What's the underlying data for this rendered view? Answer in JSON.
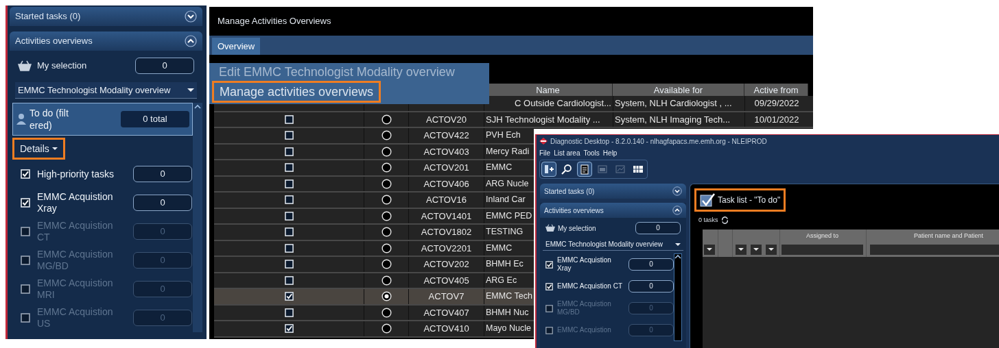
{
  "sidebar": {
    "started_tasks": {
      "label": "Started tasks (0)",
      "expanded": false
    },
    "activities": {
      "label": "Activities overviews",
      "expanded": true
    },
    "my_selection": {
      "label": "My selection",
      "count": "0"
    },
    "overview_select": {
      "value": "EMMC Technologist Modality overview"
    },
    "todo": {
      "label": "To do (filtered)",
      "count": "0 total"
    },
    "details": {
      "label": "Details",
      "highlighted": true
    },
    "filters": [
      {
        "label": "High-priority tasks",
        "count": "0",
        "checked": true,
        "disabled": false
      },
      {
        "label": "EMMC Acquistion Xray",
        "count": "0",
        "checked": true,
        "disabled": false
      },
      {
        "label": "EMMC Acquistion CT",
        "count": "0",
        "checked": false,
        "disabled": true
      },
      {
        "label": "EMMC Acquistion MG/BD",
        "count": "0",
        "checked": false,
        "disabled": true
      },
      {
        "label": "EMMC Acquistion MRI",
        "count": "0",
        "checked": false,
        "disabled": true
      },
      {
        "label": "EMMC Acquistion US",
        "count": "0",
        "checked": false,
        "disabled": true
      }
    ]
  },
  "main_window": {
    "title": "Manage Activities Overviews",
    "tabs": [
      {
        "label": "Overview",
        "selected": true
      }
    ],
    "popup": {
      "title": "Edit EMMC Technologist Modality overview",
      "subtitle": {
        "label": "Manage activities overviews",
        "highlighted": true
      }
    },
    "table": {
      "columns": [
        "Name",
        "Available for",
        "Active from"
      ],
      "rows": [
        {
          "name": "C Outside Cardiologist...",
          "available_for": "System, NLH Cardiologist , ...",
          "active_from": "09/29/2022"
        },
        {
          "checked": false,
          "selected": false,
          "id": "ACTOV20",
          "name": "SJH Technologist Modality ...",
          "available_for": "System, NLH Imaging Tech...",
          "active_from": "10/01/2022"
        },
        {
          "checked": false,
          "selected": false,
          "id": "ACTOV422",
          "name": "PVH Ech"
        },
        {
          "checked": false,
          "selected": false,
          "id": "ACTOV403",
          "name": "Mercy Radi"
        },
        {
          "checked": false,
          "selected": false,
          "id": "ACTOV201",
          "name": "EMMC"
        },
        {
          "checked": false,
          "selected": false,
          "id": "ACTOV406",
          "name": "ARG Nucle"
        },
        {
          "checked": false,
          "selected": false,
          "id": "ACTOV16",
          "name": "Inland Car"
        },
        {
          "checked": false,
          "selected": false,
          "id": "ACTOV1401",
          "name": "EMMC PED"
        },
        {
          "checked": false,
          "selected": false,
          "id": "ACTOV1802",
          "name": "TESTING"
        },
        {
          "checked": false,
          "selected": false,
          "id": "ACTOV2201",
          "name": "EMMC"
        },
        {
          "checked": false,
          "selected": false,
          "id": "ACTOV202",
          "name": "BHMH Ec"
        },
        {
          "checked": false,
          "selected": false,
          "id": "ACTOV405",
          "name": "ARG Ec"
        },
        {
          "checked": true,
          "selected": true,
          "id": "ACTOV7",
          "name": "EMMC Tech"
        },
        {
          "checked": false,
          "selected": false,
          "id": "ACTOV407",
          "name": "BHMH Nuc"
        },
        {
          "checked": true,
          "selected": false,
          "id": "ACTOV410",
          "name": "Mayo Nucle"
        }
      ]
    }
  },
  "inset_window": {
    "title": "Diagnostic Desktop - 8.2.0.140 - nlhagfapacs.me.emh.org - NLEIPROD",
    "menu": [
      "File",
      "List area",
      "Tools",
      "Help"
    ],
    "toolbar": [
      {
        "kind": "add",
        "disabled": false
      },
      {
        "kind": "search",
        "disabled": false
      },
      {
        "kind": "clipboard",
        "disabled": false
      },
      {
        "kind": "window",
        "disabled": true
      },
      {
        "kind": "chart",
        "disabled": true
      },
      {
        "kind": "grid",
        "disabled": false
      }
    ],
    "sidebar": {
      "started_tasks": {
        "label": "Started tasks (0)",
        "expanded": false
      },
      "activities": {
        "label": "Activities overviews",
        "expanded": true
      },
      "my_selection": {
        "label": "My selection",
        "count": "0"
      },
      "overview_select": {
        "value": "EMMC Technologist Modality overview"
      },
      "filters": [
        {
          "label": "EMMC Acquistion Xray",
          "count": "0",
          "checked": true,
          "disabled": false
        },
        {
          "label": "EMMC Acquistion CT",
          "count": "0",
          "checked": true,
          "disabled": false
        },
        {
          "label": "EMMC Acquistion MG/BD",
          "count": "0",
          "checked": false,
          "disabled": true
        },
        {
          "label": "EMMC Acquistion",
          "count": "0",
          "checked": false,
          "disabled": true
        }
      ]
    },
    "task_list": {
      "title": "Task list - \"To do\"",
      "highlighted": true,
      "count": "0 tasks",
      "columns": [
        {
          "kind": "filter"
        },
        {
          "kind": "blank"
        },
        {
          "kind": "filter"
        },
        {
          "kind": "filter"
        },
        {
          "kind": "filter"
        },
        {
          "kind": "text",
          "label": "Assigned to"
        },
        {
          "kind": "text",
          "label": "Patient name and Patient"
        }
      ]
    }
  }
}
